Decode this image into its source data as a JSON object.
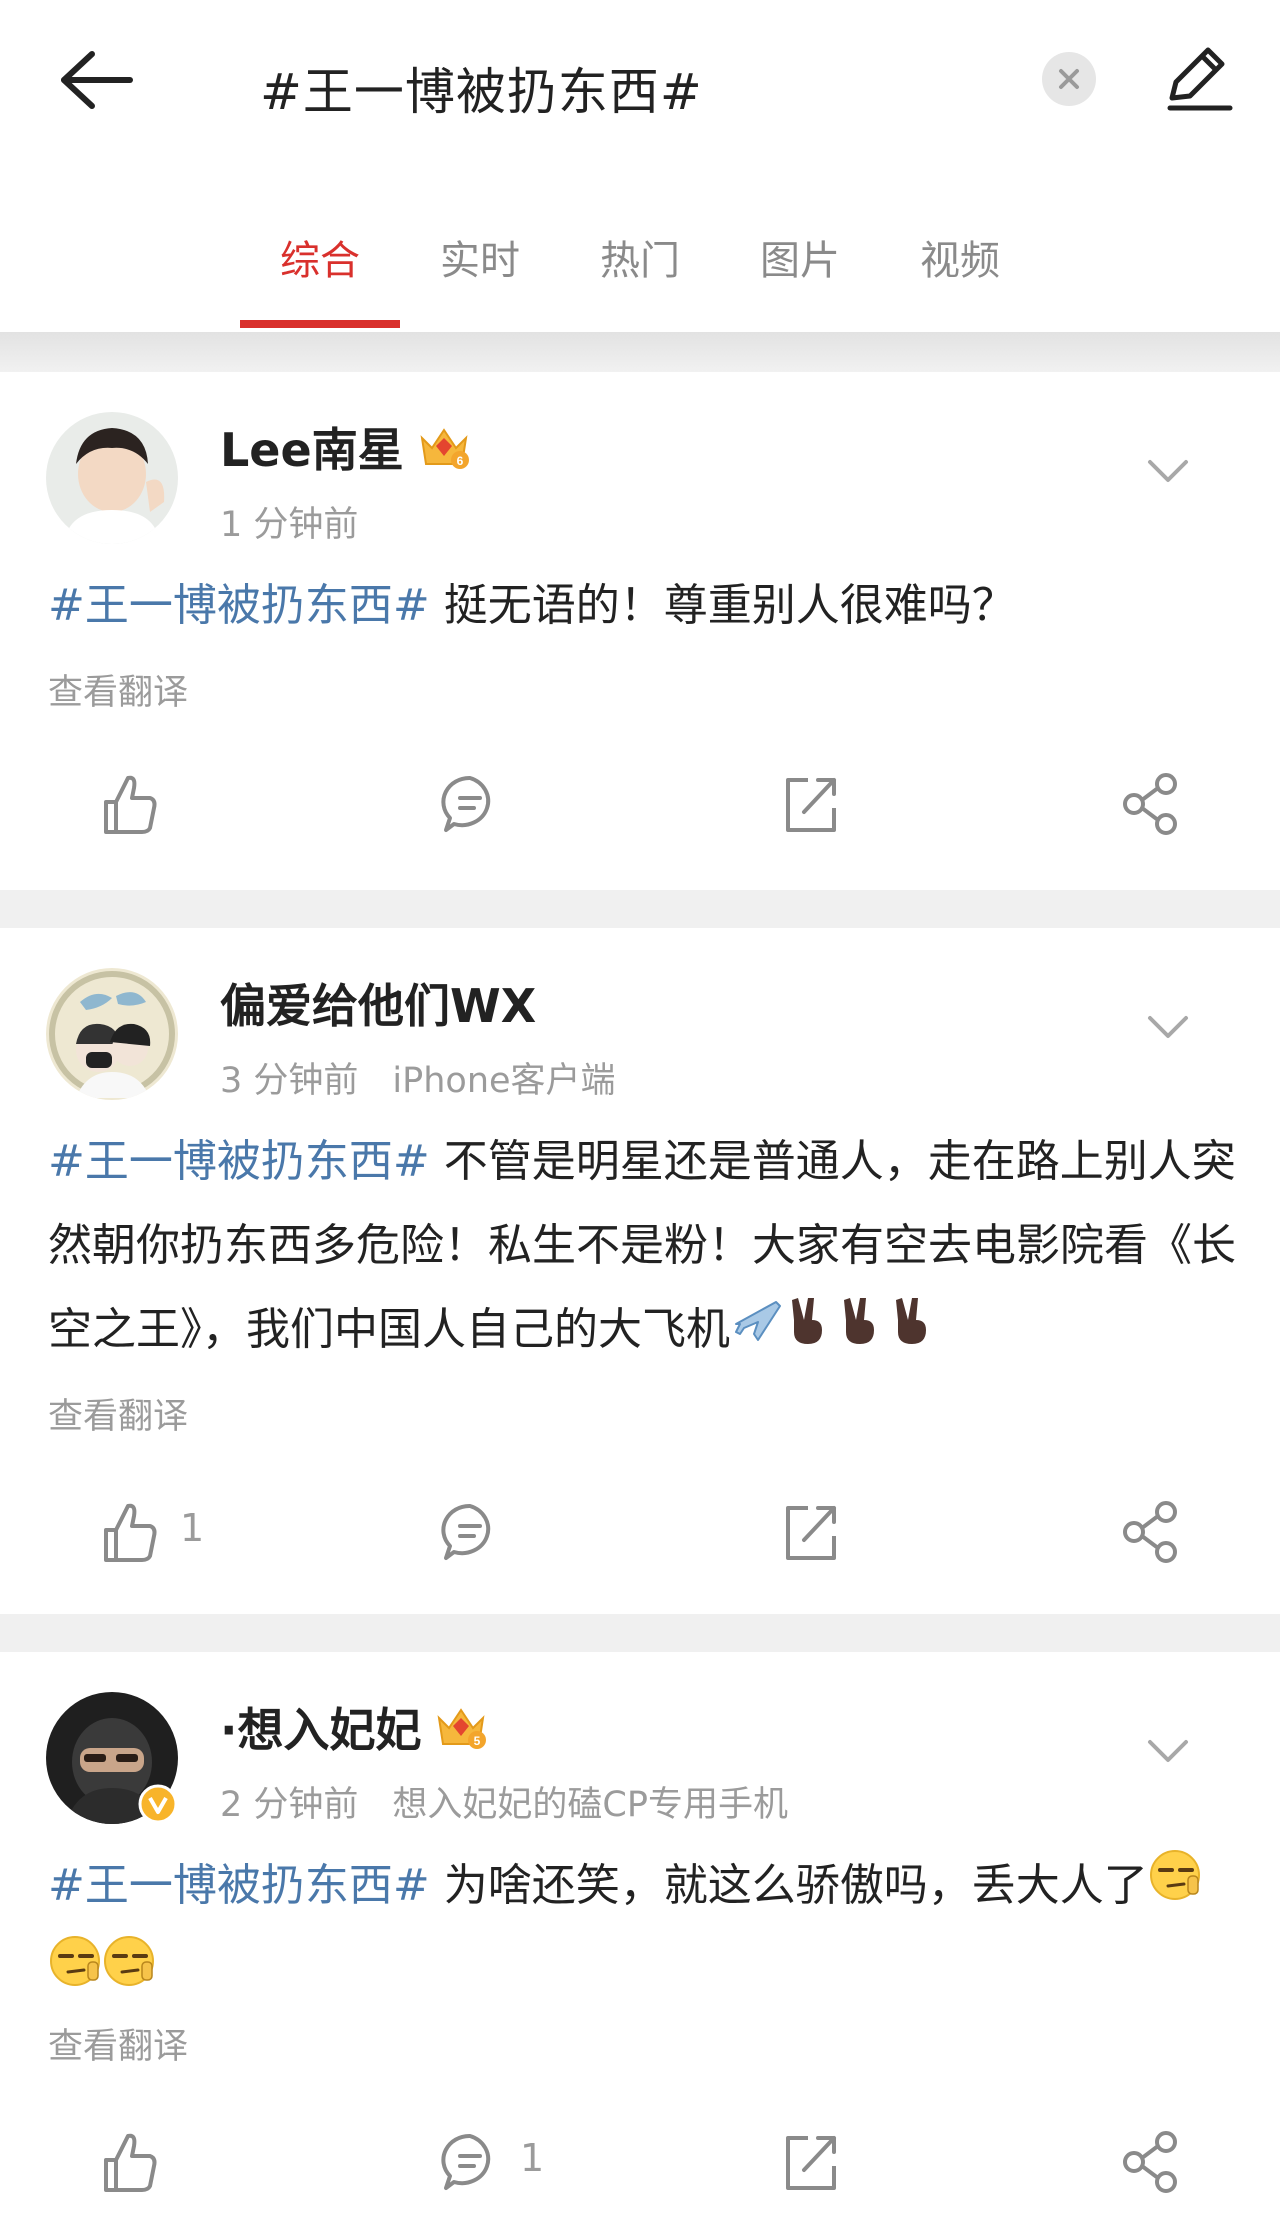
{
  "header": {
    "search_text": "#王一博被扔东西#"
  },
  "tabs": [
    {
      "label": "综合",
      "active": true
    },
    {
      "label": "实时",
      "active": false
    },
    {
      "label": "热门",
      "active": false
    },
    {
      "label": "图片",
      "active": false
    },
    {
      "label": "视频",
      "active": false
    }
  ],
  "posts": [
    {
      "user": "Lee南星",
      "time": "1 分钟前",
      "source": "",
      "hashtag": "#王一博被扔东西#",
      "text": " 挺无语的！尊重别人很难吗？",
      "translate": "查看翻译",
      "likes": "",
      "comments": ""
    },
    {
      "user": "偏爱给他们WX",
      "time": "3 分钟前",
      "source": "iPhone客户端",
      "hashtag": "#王一博被扔东西#",
      "text": " 不管是明星还是普通人，走在路上别人突然朝你扔东西多危险！私生不是粉！大家有空去电影院看《长空之王》，我们中国人自己的大飞机",
      "translate": "查看翻译",
      "likes": "1",
      "comments": ""
    },
    {
      "user": "·想入妃妃",
      "time": "2 分钟前",
      "source": "想入妃妃的磕CP专用手机",
      "hashtag": "#王一博被扔东西#",
      "text": " 为啥还笑，就这么骄傲吗，丢大人了",
      "translate": "查看翻译",
      "likes": "",
      "comments": "1"
    }
  ],
  "colors": {
    "accent": "#d9302c",
    "hashtag": "#4a78aa",
    "meta_gray": "#9b9b9b",
    "separator": "#f0f0f0"
  },
  "icons": [
    "back-arrow-icon",
    "clear-icon",
    "edit-icon",
    "chevron-down-icon",
    "like-icon",
    "comment-icon",
    "repost-icon",
    "share-icon",
    "vip-crown-icon",
    "verified-v-icon",
    "airplane-emoji",
    "victory-hand-emoji",
    "smirk-emoji"
  ]
}
